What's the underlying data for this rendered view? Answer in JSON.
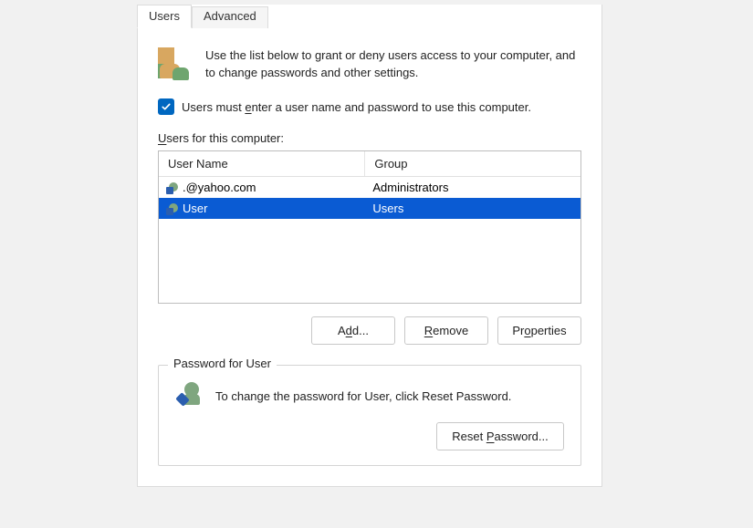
{
  "tabs": {
    "users": "Users",
    "advanced": "Advanced"
  },
  "intro": "Use the list below to grant or deny users access to your computer, and to change passwords and other settings.",
  "require_login_label_html": "Users must <u>e</u>nter a user name and password to use this computer.",
  "users_section_label_html": "<u>U</u>sers for this computer:",
  "columns": {
    "user": "User Name",
    "group": "Group"
  },
  "rows": [
    {
      "user": ".@yahoo.com",
      "group": "Administrators",
      "selected": false
    },
    {
      "user": "User",
      "group": "Users",
      "selected": true
    }
  ],
  "buttons": {
    "add_html": "A<u>d</u>d...",
    "remove_html": "<u>R</u>emove",
    "properties_html": "Pr<u>o</u>perties"
  },
  "password_group_title": "Password for User",
  "password_text": "To change the password for User, click Reset Password.",
  "reset_password_html": "Reset <u>P</u>assword..."
}
